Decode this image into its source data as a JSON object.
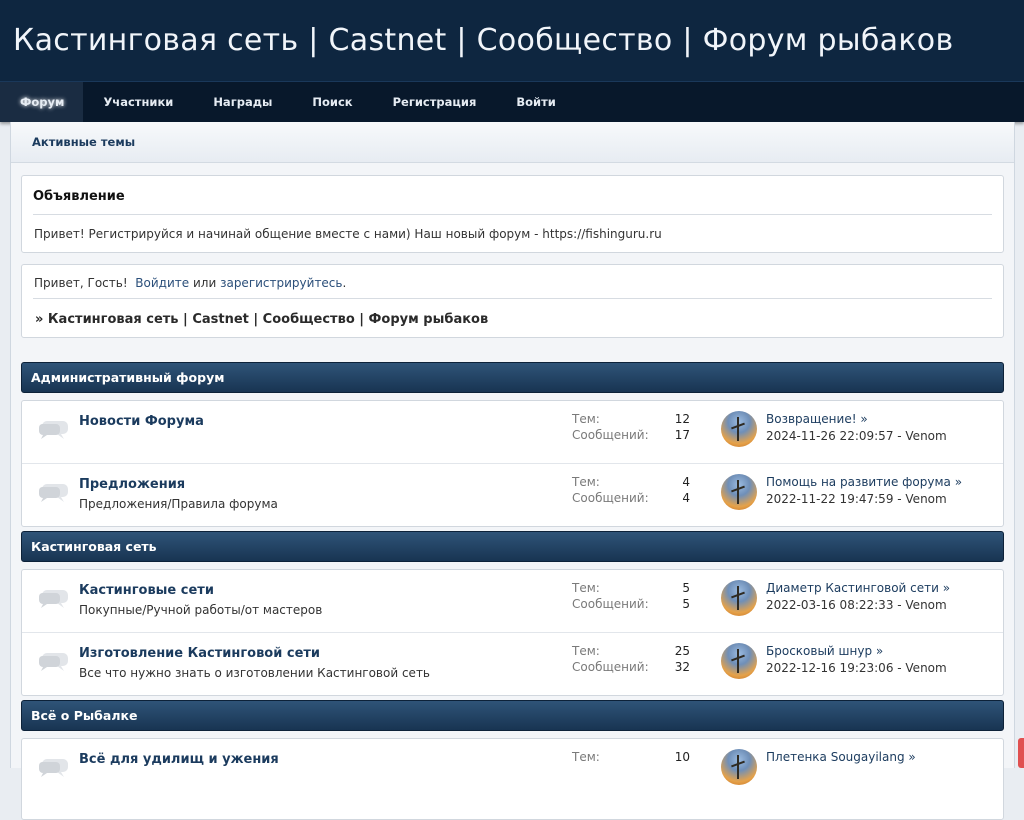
{
  "header": {
    "title": "Кастинговая сеть | Castnet | Сообщество | Форум рыбаков"
  },
  "nav": {
    "items": [
      {
        "label": "Форум"
      },
      {
        "label": "Участники"
      },
      {
        "label": "Награды"
      },
      {
        "label": "Поиск"
      },
      {
        "label": "Регистрация"
      },
      {
        "label": "Войти"
      }
    ]
  },
  "subnav": {
    "active_topics": "Активные темы"
  },
  "announcement": {
    "title": "Объявление",
    "text": "Привет! Регистрируйся и начинай общение вместе с нами) Наш новый форум - https://fishinguru.ru"
  },
  "greeting": {
    "prefix": "Привет, Гость!",
    "login_link": "Войдите",
    "or": "или",
    "register_link": "зарегистрируйтесь",
    "suffix": ".",
    "breadcrumb": "» Кастинговая сеть | Castnet | Сообщество | Форум рыбаков"
  },
  "labels": {
    "topics": "Тем:",
    "posts": "Сообщений:"
  },
  "categories": [
    {
      "title": "Административный форум",
      "boards": [
        {
          "name": "Новости Форума",
          "desc": "",
          "topics": "12",
          "posts": "17",
          "last_topic": "Возвращение! »",
          "last_meta": "2024-11-26 22:09:57 - Venom"
        },
        {
          "name": "Предложения",
          "desc": "Предложения/Правила форума",
          "topics": "4",
          "posts": "4",
          "last_topic": "Помощь на развитие форума »",
          "last_meta": "2022-11-22 19:47:59 - Venom"
        }
      ]
    },
    {
      "title": "Кастинговая сеть",
      "boards": [
        {
          "name": "Кастинговые сети",
          "desc": "Покупные/Ручной работы/от мастеров",
          "topics": "5",
          "posts": "5",
          "last_topic": "Диаметр Кастинговой сети »",
          "last_meta": "2022-03-16 08:22:33 - Venom"
        },
        {
          "name": "Изготовление Кастинговой сети",
          "desc": "Все что нужно знать о изготовлении Кастинговой сеть",
          "topics": "25",
          "posts": "32",
          "last_topic": "Бросковый шнур »",
          "last_meta": "2022-12-16 19:23:06 - Venom"
        }
      ]
    },
    {
      "title": "Всё о Рыбалке",
      "boards": [
        {
          "name": "Всё для удилищ и ужения",
          "desc": "",
          "topics": "10",
          "posts": "",
          "last_topic": "Плетенка Sougayilang »",
          "last_meta": ""
        }
      ]
    }
  ],
  "colors": {
    "header_bg": "#0e2640",
    "nav_bg": "#08182b",
    "category_bar": "#2f5478",
    "link": "#1b3b5e"
  }
}
